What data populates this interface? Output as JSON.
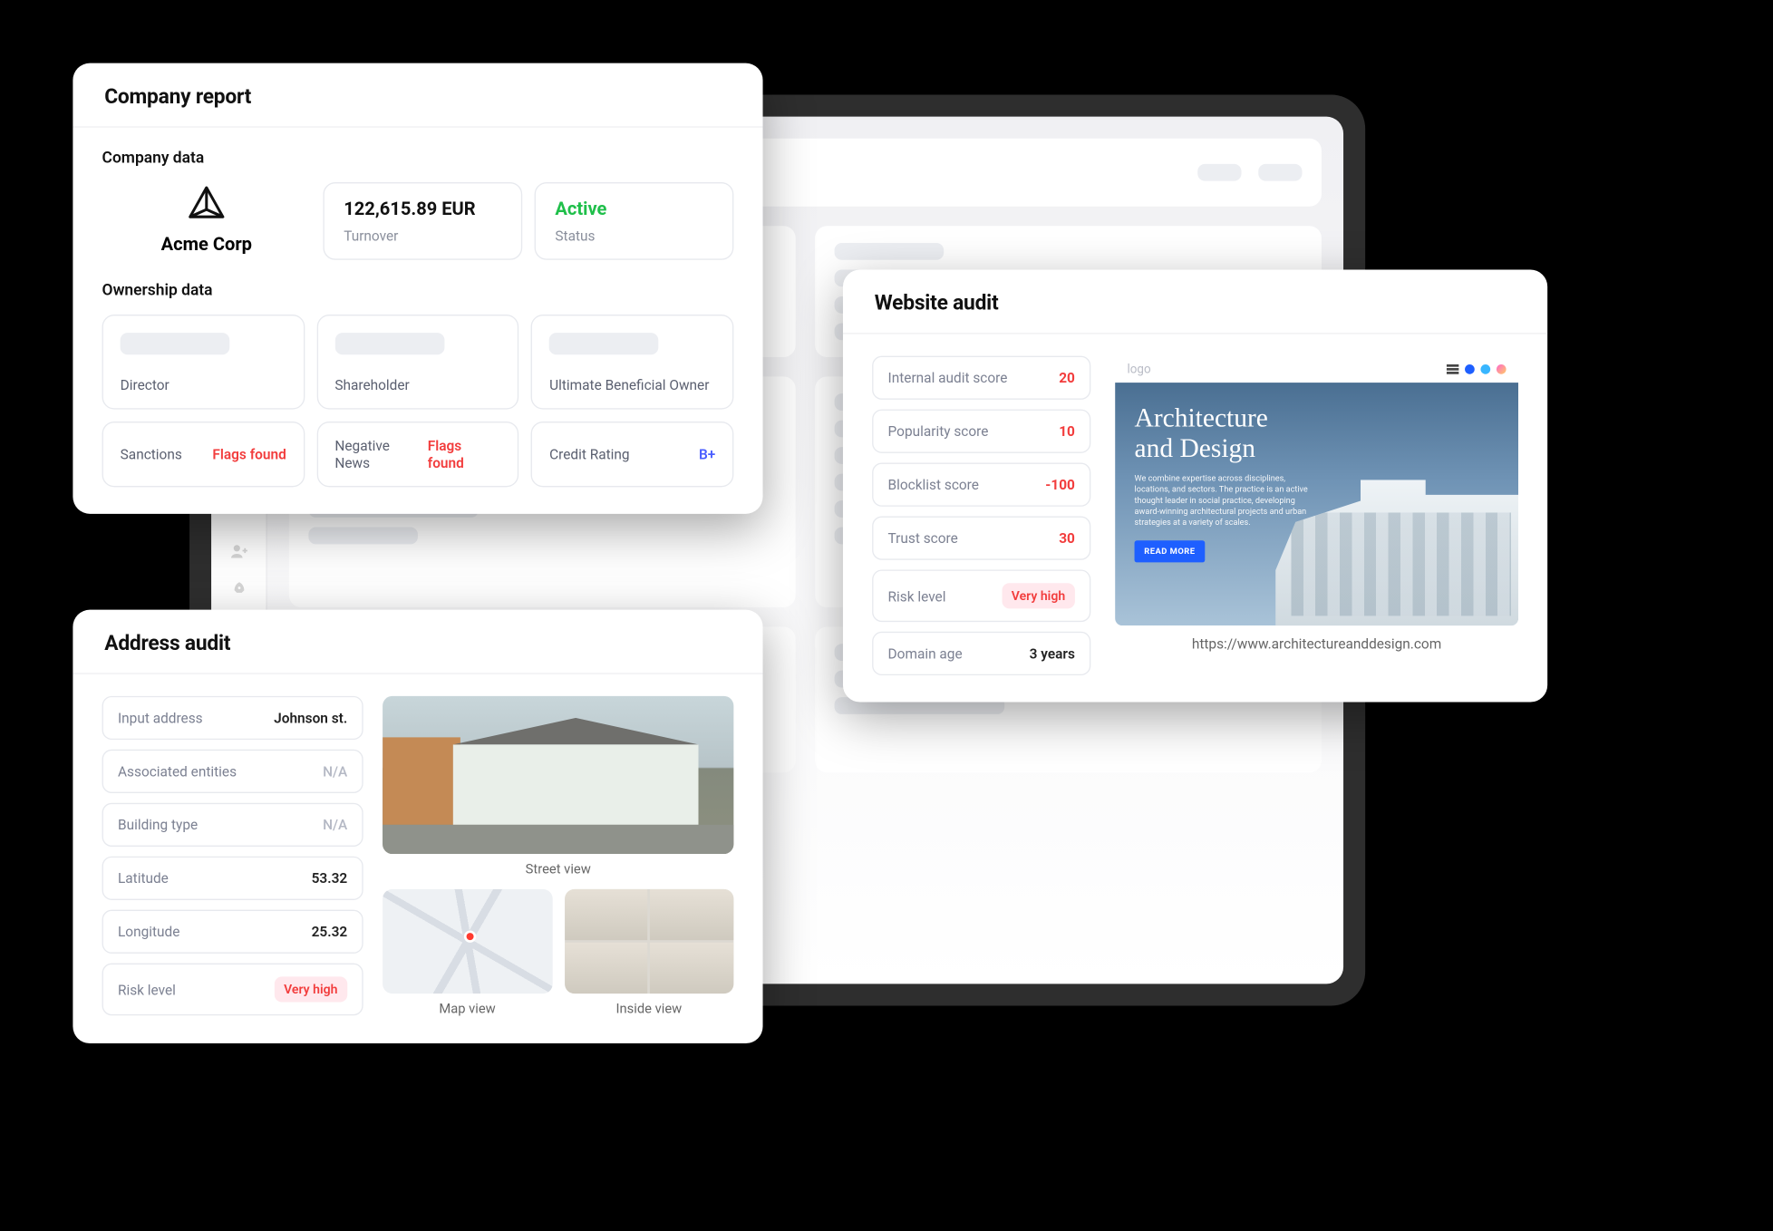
{
  "company_report": {
    "title": "Company report",
    "section_company_data": "Company data",
    "section_ownership": "Ownership data",
    "company_name": "Acme Corp",
    "turnover": {
      "value": "122,615.89 EUR",
      "label": "Turnover"
    },
    "status": {
      "value": "Active",
      "label": "Status"
    },
    "ownership": {
      "director": "Director",
      "shareholder": "Shareholder",
      "ubo": "Ultimate Beneficial Owner"
    },
    "flags": {
      "sanctions": {
        "label": "Sanctions",
        "value": "Flags found"
      },
      "negative_news": {
        "label": "Negative News",
        "value": "Flags found"
      },
      "credit": {
        "label": "Credit Rating",
        "value": "B+"
      }
    }
  },
  "address_audit": {
    "title": "Address audit",
    "rows": {
      "input_address": {
        "label": "Input address",
        "value": "Johnson st."
      },
      "associated_entities": {
        "label": "Associated entities",
        "value": "N/A"
      },
      "building_type": {
        "label": "Building type",
        "value": "N/A"
      },
      "latitude": {
        "label": "Latitude",
        "value": "53.32"
      },
      "longitude": {
        "label": "Longitude",
        "value": "25.32"
      },
      "risk_level": {
        "label": "Risk level",
        "value": "Very high"
      }
    },
    "captions": {
      "street": "Street view",
      "map": "Map view",
      "inside": "Inside view"
    }
  },
  "website_audit": {
    "title": "Website audit",
    "rows": {
      "internal": {
        "label": "Internal audit score",
        "value": "20"
      },
      "popularity": {
        "label": "Popularity score",
        "value": "10"
      },
      "blocklist": {
        "label": "Blocklist score",
        "value": "-100"
      },
      "trust": {
        "label": "Trust score",
        "value": "30"
      },
      "risk": {
        "label": "Risk level",
        "value": "Very high"
      },
      "domain_age": {
        "label": "Domain age",
        "value": "3 years"
      }
    },
    "mock": {
      "logo": "logo",
      "headline1": "Architecture",
      "headline2": "and Design",
      "body": "We combine expertise across disciplines, locations, and sectors. The practice is an active thought leader in social practice, developing award-winning architectural projects and urban strategies at a variety of scales.",
      "cta": "READ MORE",
      "url": "https://www.architectureanddesign.com"
    }
  }
}
